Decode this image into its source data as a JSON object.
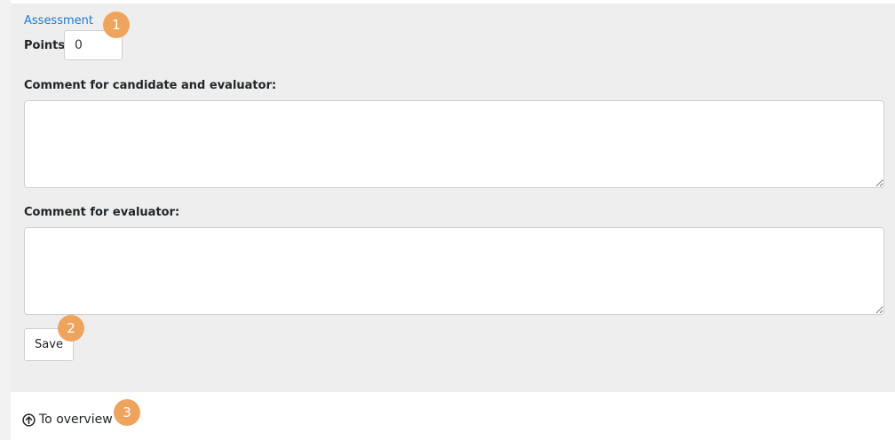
{
  "assessment": {
    "title": "Assessment",
    "points_label": "Points:",
    "points_value": "0",
    "comment_candidate_label": "Comment for candidate and evaluator:",
    "comment_candidate_value": "",
    "comment_evaluator_label": "Comment for evaluator:",
    "comment_evaluator_value": "",
    "save_label": "Save"
  },
  "footer": {
    "overview_label": "To overview",
    "overview_icon": "circle-arrow-up-icon"
  },
  "annotations": [
    "1",
    "2",
    "3"
  ],
  "colors": {
    "panel_bg": "#eeeeee",
    "link": "#1a7bd4",
    "badge": "#efa45d"
  }
}
